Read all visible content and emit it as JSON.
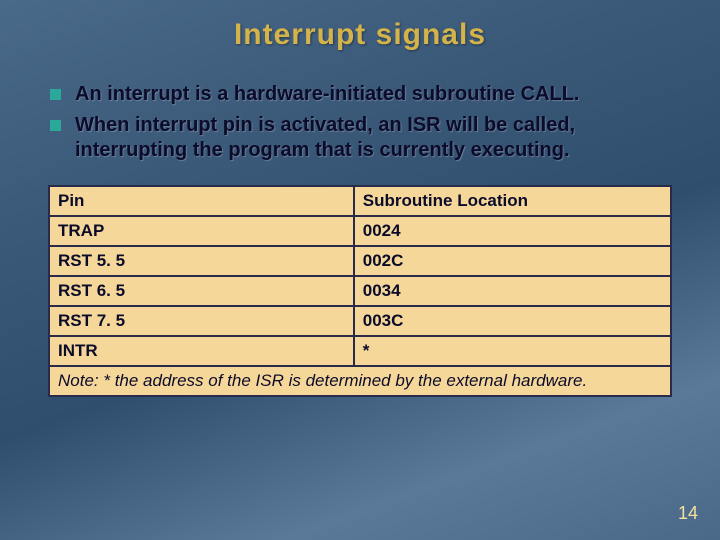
{
  "title": "Interrupt signals",
  "bullets": [
    "An interrupt is a hardware-initiated subroutine CALL.",
    "When interrupt pin is activated, an ISR will be called, interrupting the program that is currently executing."
  ],
  "table": {
    "headers": [
      "Pin",
      "Subroutine Location"
    ],
    "rows": [
      [
        "TRAP",
        "0024"
      ],
      [
        "RST 5. 5",
        "002C"
      ],
      [
        "RST 6. 5",
        "0034"
      ],
      [
        "RST 7. 5",
        "003C"
      ],
      [
        "INTR",
        "*"
      ]
    ],
    "note": "Note: * the address of the ISR is determined by the external hardware."
  },
  "page_number": "14"
}
